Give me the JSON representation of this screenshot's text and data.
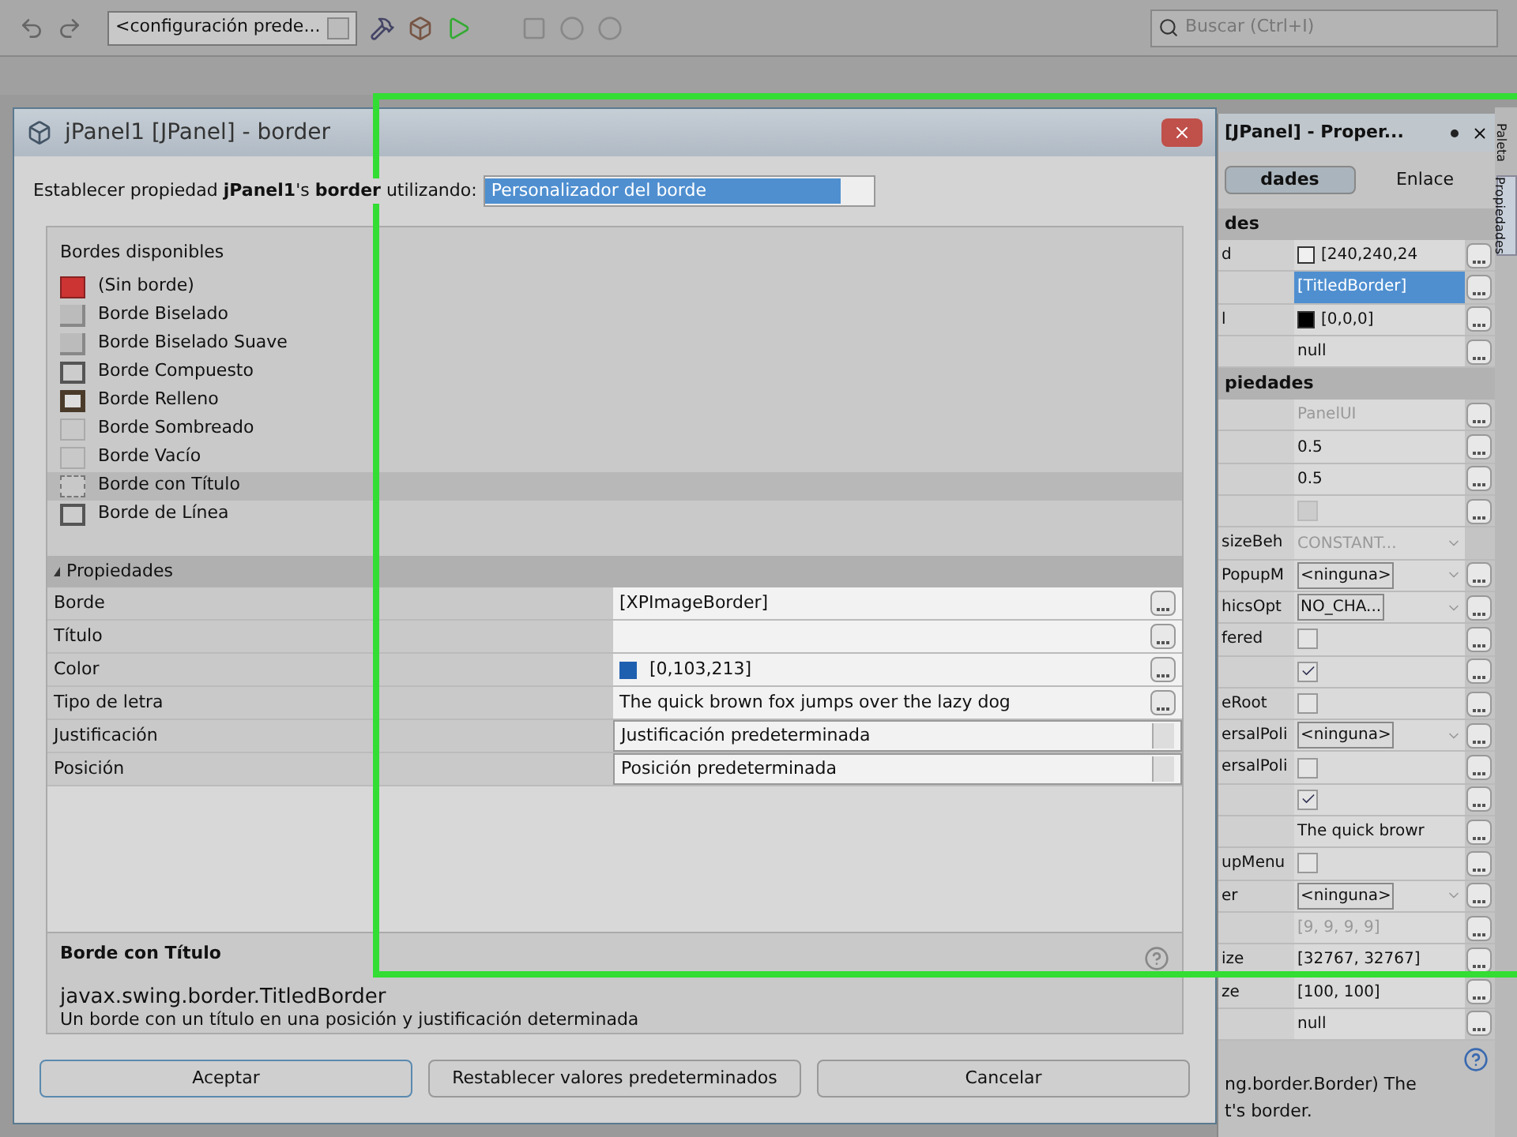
{
  "toolbar": {
    "config": "<configuración prede...",
    "search": {
      "placeholder": "Buscar (Ctrl+I)"
    }
  },
  "dialog": {
    "title": "jPanel1 [JPanel] - border",
    "prompt": "Establecer propiedad **jPanel1**'s **border** utilizando:",
    "editor": "Personalizador del borde",
    "borders_heading": "Bordes disponibles",
    "borders": [
      {
        "label": "(Sin borde)",
        "kind": "none",
        "selected": false
      },
      {
        "label": "Borde Biselado",
        "kind": "bevel",
        "selected": false
      },
      {
        "label": "Borde Biselado Suave",
        "kind": "bevel",
        "selected": false
      },
      {
        "label": "Borde Compuesto",
        "kind": "plain",
        "selected": false
      },
      {
        "label": "Borde Relleno",
        "kind": "matte",
        "selected": false
      },
      {
        "label": "Borde Sombreado",
        "kind": "flat",
        "selected": false
      },
      {
        "label": "Borde Vacío",
        "kind": "flat",
        "selected": false
      },
      {
        "label": "Borde con Título",
        "kind": "titled",
        "selected": true
      },
      {
        "label": "Borde de Línea",
        "kind": "plain",
        "selected": false
      }
    ],
    "properties_heading": "Propiedades",
    "properties": [
      {
        "name": "Borde",
        "value": "[XPImageBorder]",
        "kind": "text"
      },
      {
        "name": "Título",
        "kind": "text"
      },
      {
        "name": "Color",
        "value": "[0,103,213]",
        "kind": "color",
        "color": "#1f5fb0"
      },
      {
        "name": "Tipo de letra",
        "value": "The quick brown fox jumps over the lazy dog",
        "kind": "text"
      },
      {
        "name": "Justificación",
        "value": "Justificación predeterminada",
        "kind": "combo"
      },
      {
        "name": "Posición",
        "value": "Posición predeterminada",
        "kind": "combo"
      }
    ],
    "description": {
      "title": "Borde con Título",
      "class": "javax.swing.border.TitledBorder",
      "text": "Un borde con un título en una posición y justificación determinada"
    },
    "buttons": [
      {
        "label": "Aceptar",
        "selected": true
      },
      {
        "label": "Restablecer valores predeterminados",
        "selected": false
      },
      {
        "label": "Cancelar",
        "selected": false
      }
    ]
  },
  "properties_panel": {
    "title": "[JPanel] - Proper...",
    "tabs": [
      {
        "label": "dades",
        "selected": true
      },
      {
        "label": "Enlace",
        "selected": false
      }
    ],
    "rows": [
      {
        "kind": "section",
        "name": "des"
      },
      {
        "kind": "color",
        "name": "d",
        "value": "[240,240,24",
        "color": "#f0f0f0",
        "selected": false,
        "disabled": false
      },
      {
        "kind": "text",
        "value": "[TitledBorder]",
        "selected": true,
        "disabled": false
      },
      {
        "kind": "color",
        "name": "l",
        "value": "[0,0,0]",
        "color": "#000000",
        "selected": false,
        "disabled": false
      },
      {
        "kind": "text",
        "value": "null",
        "selected": false,
        "disabled": false
      },
      {
        "kind": "section",
        "name": "piedades"
      },
      {
        "kind": "text",
        "value": "PanelUI",
        "selected": false,
        "disabled": true
      },
      {
        "kind": "text",
        "value": "0.5",
        "selected": false,
        "disabled": false
      },
      {
        "kind": "text",
        "value": "0.5",
        "selected": false,
        "disabled": false
      },
      {
        "kind": "checkbox",
        "checked": false,
        "selected": false,
        "disabled": true
      },
      {
        "kind": "combo",
        "name": "sizeBeh",
        "value": "CONSTANT...",
        "selected": false,
        "disabled": true
      },
      {
        "kind": "combo",
        "name": "PopupM",
        "value": "<ninguna>",
        "selected": false,
        "disabled": false
      },
      {
        "kind": "combo",
        "name": "hicsOpt",
        "value": "NO_CHA...",
        "selected": false,
        "disabled": false
      },
      {
        "kind": "checkbox",
        "name": "fered",
        "checked": false,
        "selected": false,
        "disabled": false
      },
      {
        "kind": "checkbox",
        "checked": true,
        "selected": false,
        "disabled": false
      },
      {
        "kind": "checkbox",
        "name": "eRoot",
        "checked": false,
        "selected": false,
        "disabled": false
      },
      {
        "kind": "combo",
        "name": "ersalPoli",
        "value": "<ninguna>",
        "selected": false,
        "disabled": false
      },
      {
        "kind": "checkbox",
        "name": "ersalPoli",
        "checked": false,
        "selected": false,
        "disabled": false
      },
      {
        "kind": "checkbox",
        "checked": true,
        "selected": false,
        "disabled": false
      },
      {
        "kind": "text",
        "value": "The quick browr",
        "selected": false,
        "disabled": false
      },
      {
        "kind": "checkbox",
        "name": "upMenu",
        "checked": false,
        "selected": false,
        "disabled": false
      },
      {
        "kind": "combo",
        "name": "er",
        "value": "<ninguna>",
        "selected": false,
        "disabled": false
      },
      {
        "kind": "text",
        "value": "[9, 9, 9, 9]",
        "selected": false,
        "disabled": true
      },
      {
        "kind": "text",
        "name": "ize",
        "value": "[32767, 32767]",
        "selected": false,
        "disabled": false
      },
      {
        "kind": "text",
        "name": "ze",
        "value": "[100, 100]",
        "selected": false,
        "disabled": false
      },
      {
        "kind": "text",
        "value": "null",
        "selected": false,
        "disabled": false
      }
    ],
    "help_lines": [
      "ng.border.Border) The",
      "t's border."
    ]
  },
  "side_tabs": [
    {
      "label": "Paleta",
      "selected": false
    },
    {
      "label": "Propiedades",
      "selected": true
    }
  ]
}
